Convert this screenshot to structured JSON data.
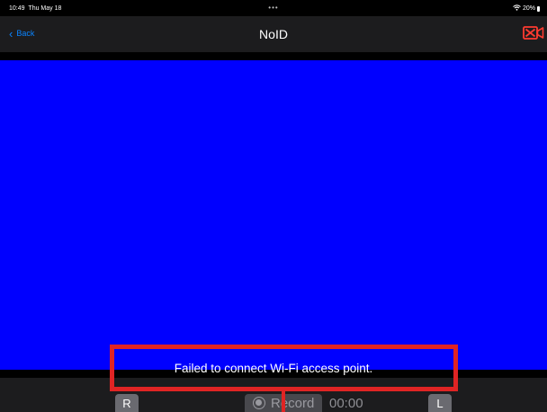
{
  "status_bar": {
    "time": "10:49",
    "date": "Thu May 18",
    "dots": "•••",
    "battery": "20%",
    "wifi_icon": "wifi-icon",
    "battery_icon": "battery-icon"
  },
  "nav": {
    "back_label": "Back",
    "back_icon": "chevron-left-icon",
    "title": "NoID",
    "action_icon": "camera-off-icon"
  },
  "video": {
    "background_color": "#0000FF",
    "error_message": "Failed to connect Wi-Fi access point."
  },
  "controls": {
    "r_label": "R",
    "record_label": "Record",
    "record_icon": "record-icon",
    "timer": "00:00",
    "l_label": "L"
  },
  "annotation": {
    "color": "#E02424"
  }
}
